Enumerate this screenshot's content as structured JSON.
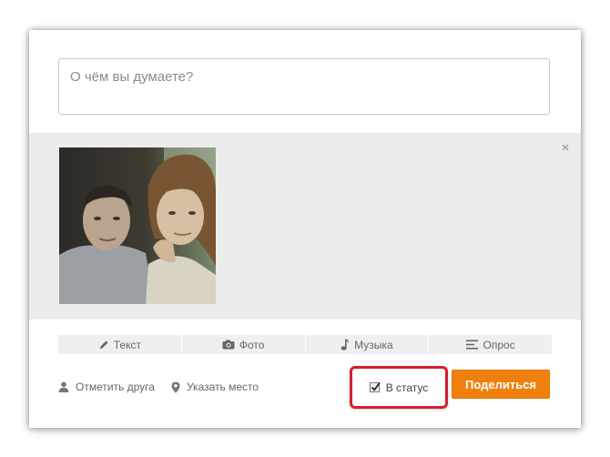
{
  "composer": {
    "placeholder": "О чём вы думаете?"
  },
  "attachment": {
    "close_label": "×",
    "photo_icon": "couple-photo"
  },
  "tabs": [
    {
      "label": "Текст",
      "icon": "pencil-icon"
    },
    {
      "label": "Фото",
      "icon": "camera-icon"
    },
    {
      "label": "Музыка",
      "icon": "music-note-icon"
    },
    {
      "label": "Опрос",
      "icon": "poll-icon"
    }
  ],
  "actions": {
    "tag_friend": "Отметить друга",
    "location": "Указать место"
  },
  "status": {
    "label": "В статус",
    "checked": true,
    "highlight_color": "#d0202e"
  },
  "share": {
    "label": "Поделиться",
    "color": "#f0800e"
  }
}
